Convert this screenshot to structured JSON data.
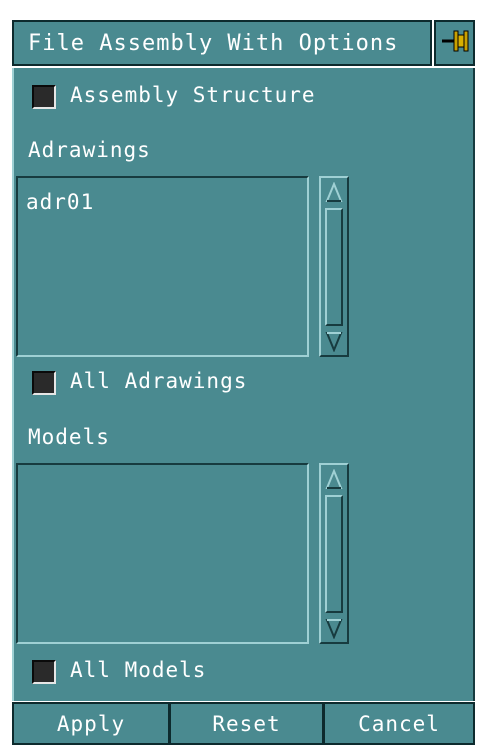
{
  "dialog": {
    "title": "File Assembly With Options",
    "pin_icon": "pushpin-icon"
  },
  "options": {
    "assembly_structure_label": "Assembly Structure",
    "assembly_structure_checked": false
  },
  "adrawings": {
    "label": "Adrawings",
    "items": [
      "adr01"
    ],
    "all_label": "All Adrawings",
    "all_checked": false
  },
  "models": {
    "label": "Models",
    "items": [],
    "all_label": "All Models",
    "all_checked": false
  },
  "buttons": {
    "apply": "Apply",
    "reset": "Reset",
    "cancel": "Cancel"
  },
  "colors": {
    "panel": "#4a8a90",
    "text": "#ffffff",
    "checkbox": "#2a2a2a"
  }
}
